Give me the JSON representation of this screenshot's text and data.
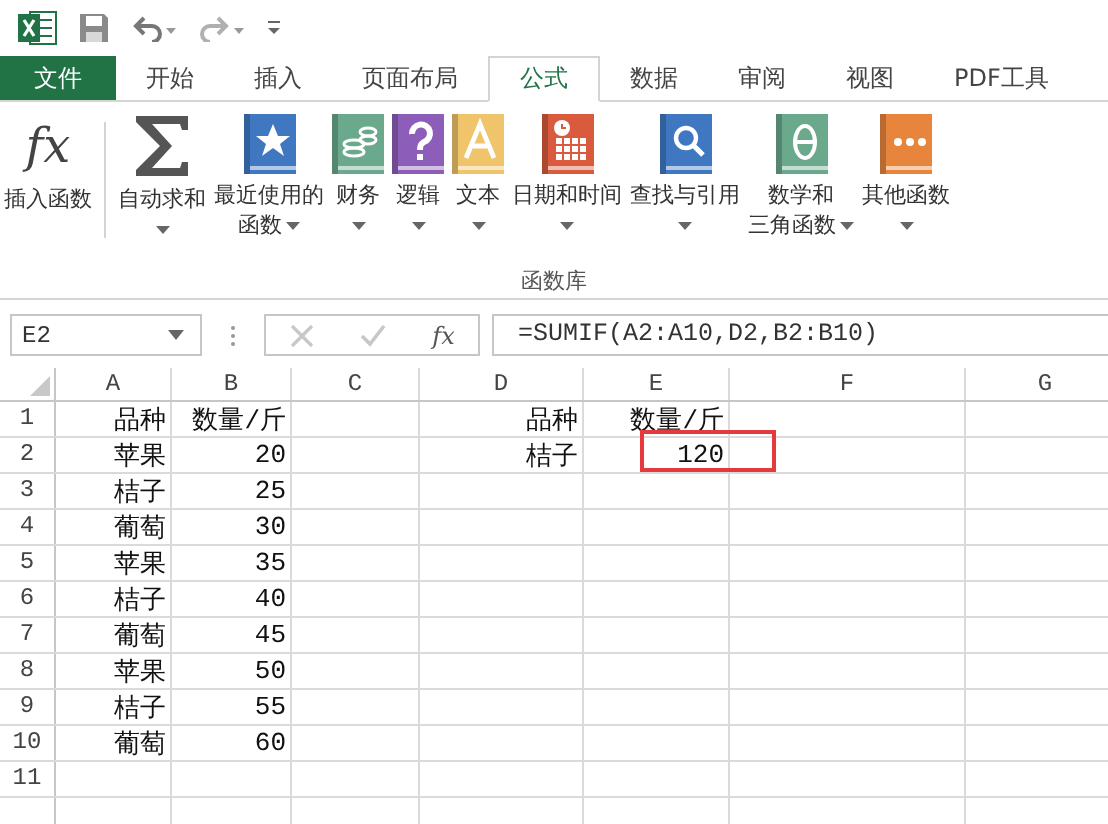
{
  "quick_access": {
    "undo_enabled": true,
    "redo_enabled": false
  },
  "tabs": [
    {
      "label": "文件",
      "kind": "file",
      "selected": false
    },
    {
      "label": "开始",
      "kind": "tab",
      "selected": false
    },
    {
      "label": "插入",
      "kind": "tab",
      "selected": false
    },
    {
      "label": "页面布局",
      "kind": "tab",
      "selected": false
    },
    {
      "label": "公式",
      "kind": "tab",
      "selected": true
    },
    {
      "label": "数据",
      "kind": "tab",
      "selected": false
    },
    {
      "label": "审阅",
      "kind": "tab",
      "selected": false
    },
    {
      "label": "视图",
      "kind": "tab",
      "selected": false
    },
    {
      "label": "PDF工具",
      "kind": "tab",
      "selected": false
    }
  ],
  "ribbon": {
    "group_label": "函数库",
    "buttons": [
      {
        "kind": "fx",
        "icon_text": "fx",
        "lines": [
          "插入函数"
        ],
        "dropdown": false
      },
      {
        "kind": "sigma",
        "lines": [
          "自动求和"
        ],
        "dropdown": true
      },
      {
        "kind": "star",
        "color": "#3f78c1",
        "lines": [
          "最近使用的",
          "函数"
        ],
        "dropdown": true
      },
      {
        "kind": "coins",
        "color": "#6ba98c",
        "lines": [
          "财务"
        ],
        "dropdown": true
      },
      {
        "kind": "question",
        "color": "#8d5eb9",
        "lines": [
          "逻辑"
        ],
        "dropdown": true
      },
      {
        "kind": "letter",
        "color": "#efc46a",
        "lines": [
          "文本"
        ],
        "dropdown": true
      },
      {
        "kind": "calendar",
        "color": "#d95a3c",
        "lines": [
          "日期和时间"
        ],
        "dropdown": true
      },
      {
        "kind": "magnifier",
        "color": "#3f78c1",
        "lines": [
          "查找与引用"
        ],
        "dropdown": true
      },
      {
        "kind": "theta",
        "color": "#6ba98c",
        "lines": [
          "数学和",
          "三角函数"
        ],
        "dropdown": true
      },
      {
        "kind": "dots",
        "color": "#e8853c",
        "lines": [
          "其他函数"
        ],
        "dropdown": true
      }
    ]
  },
  "formula_bar": {
    "name_box": "E2",
    "fx_text": "fx",
    "cancel_enabled": false,
    "enter_enabled": false,
    "formula": "=SUMIF(A2:A10,D2,B2:B10)"
  },
  "sheet": {
    "columns": [
      "A",
      "B",
      "C",
      "D",
      "E",
      "F",
      "G"
    ],
    "rows": [
      {
        "number": "1",
        "cells": {
          "A": "品种",
          "B": "数量/斤",
          "D": "品种",
          "E": "数量/斤"
        }
      },
      {
        "number": "2",
        "cells": {
          "A": "苹果",
          "B": "20",
          "D": "桔子",
          "E": {
            "text": "120",
            "outlined": true
          }
        }
      },
      {
        "number": "3",
        "cells": {
          "A": "桔子",
          "B": "25"
        }
      },
      {
        "number": "4",
        "cells": {
          "A": "葡萄",
          "B": "30"
        }
      },
      {
        "number": "5",
        "cells": {
          "A": "苹果",
          "B": "35"
        }
      },
      {
        "number": "6",
        "cells": {
          "A": "桔子",
          "B": "40"
        }
      },
      {
        "number": "7",
        "cells": {
          "A": "葡萄",
          "B": "45"
        }
      },
      {
        "number": "8",
        "cells": {
          "A": "苹果",
          "B": "50"
        }
      },
      {
        "number": "9",
        "cells": {
          "A": "桔子",
          "B": "55"
        }
      },
      {
        "number": "10",
        "cells": {
          "A": "葡萄",
          "B": "60"
        }
      },
      {
        "number": "11",
        "cells": {}
      }
    ]
  }
}
